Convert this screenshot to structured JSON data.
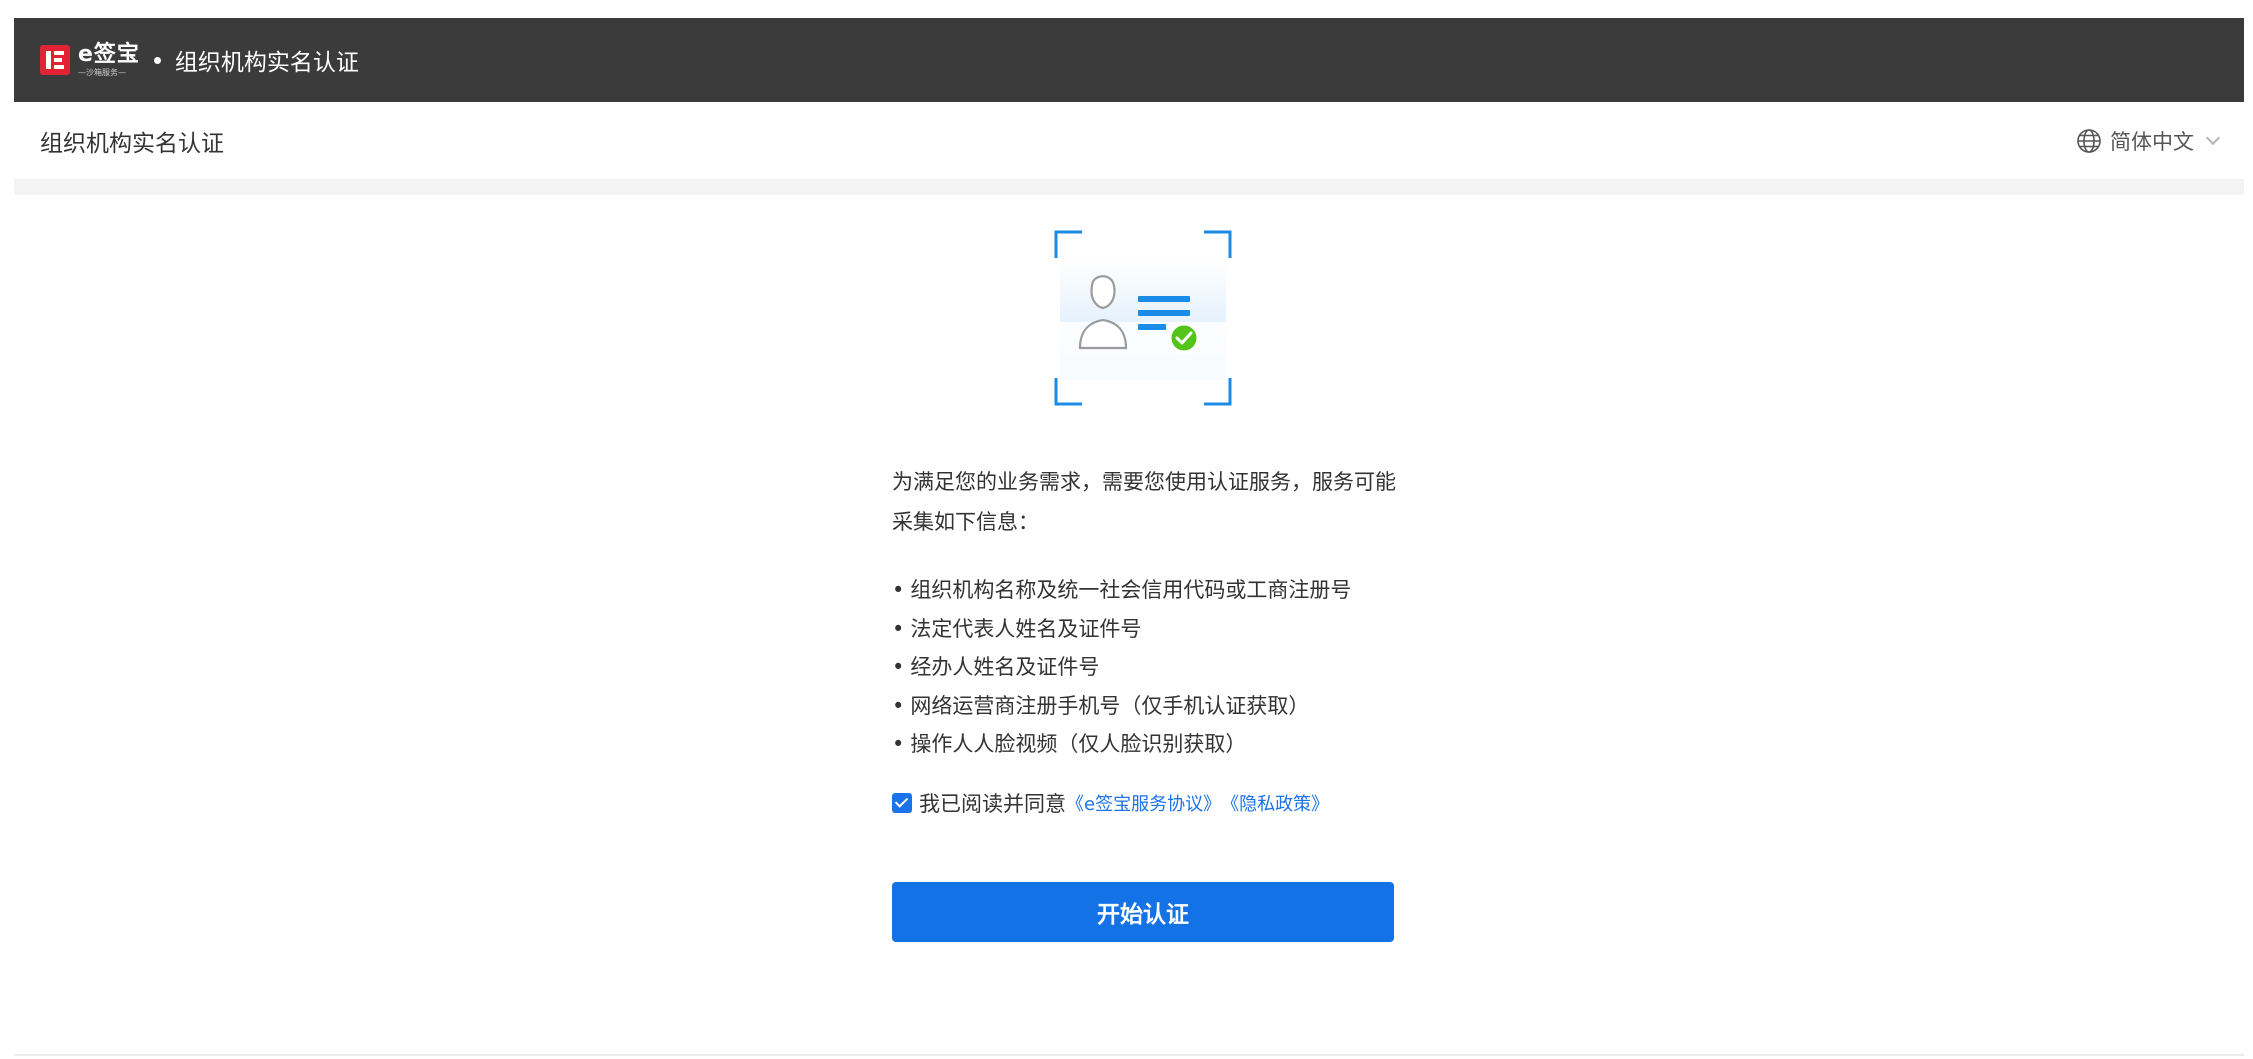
{
  "header": {
    "brand": "e签宝",
    "brand_sub": "—沙箱服务—",
    "title": "组织机构实名认证"
  },
  "subheader": {
    "page_title": "组织机构实名认证",
    "language": "简体中文"
  },
  "intro_text": "为满足您的业务需求，需要您使用认证服务，服务可能采集如下信息：",
  "info_items": [
    "组织机构名称及统一社会信用代码或工商注册号",
    "法定代表人姓名及证件号",
    "经办人姓名及证件号",
    "网络运营商注册手机号（仅手机认证获取）",
    "操作人人脸视频（仅人脸识别获取）"
  ],
  "agreement": {
    "checked": true,
    "prefix": "我已阅读并同意",
    "service_link": "《e签宝服务协议》",
    "privacy_link": "《隐私政策》"
  },
  "start_button": "开始认证",
  "colors": {
    "topbar": "#3b3b3b",
    "brand_red": "#e02433",
    "primary_blue": "#1373e6",
    "link_blue": "#1a73e8",
    "success_green": "#52c41a"
  }
}
